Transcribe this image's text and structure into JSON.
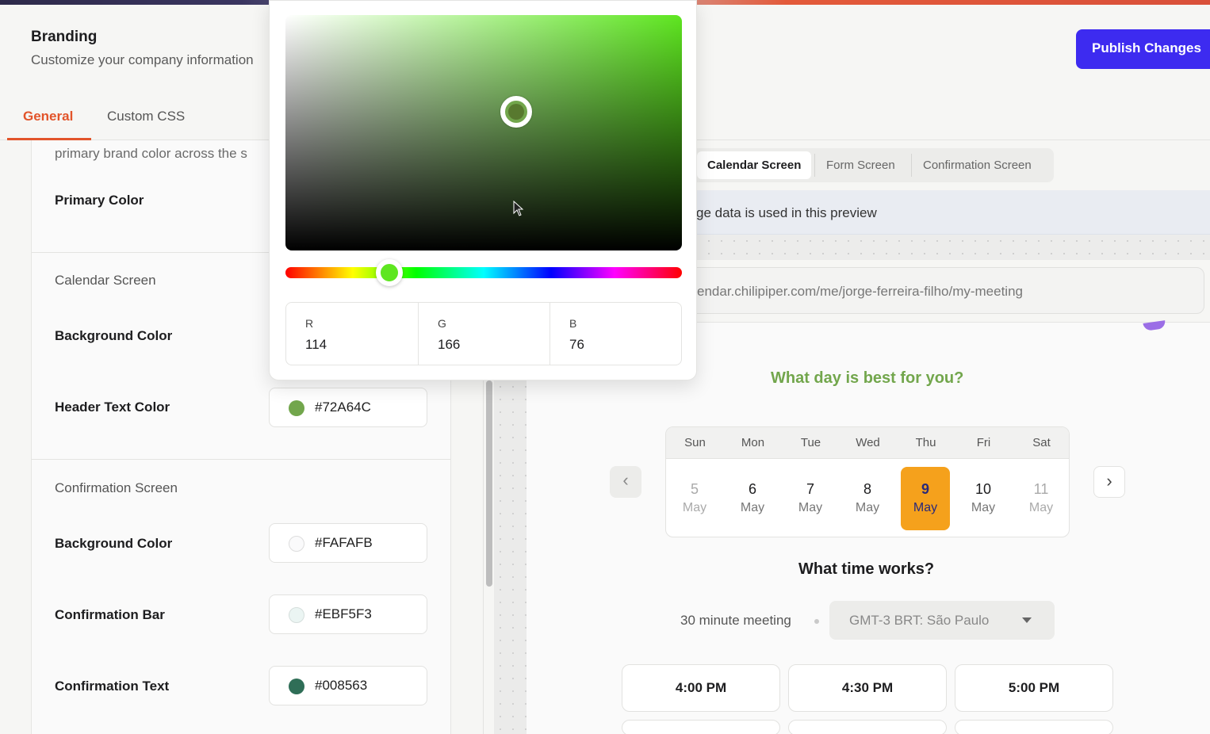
{
  "header": {
    "title": "Branding",
    "subtitle": "Customize your company information",
    "publish_label": "Publish Changes"
  },
  "tabs": [
    {
      "label": "General",
      "active": true
    },
    {
      "label": "Custom CSS",
      "active": false
    }
  ],
  "settings": {
    "intro_text": "primary brand color across the s",
    "primary_color_label": "Primary Color",
    "calendar_section": {
      "title": "Calendar Screen",
      "background_label": "Background Color",
      "header_text_label": "Header Text Color",
      "header_text_value": "#72A64C"
    },
    "confirmation_section": {
      "title": "Confirmation Screen",
      "background_label": "Background Color",
      "background_value": "#FAFAFB",
      "bar_label": "Confirmation Bar",
      "bar_value": "#EBF5F3",
      "text_label": "Confirmation Text",
      "text_value": "#008563"
    }
  },
  "color_picker": {
    "selected_color": "#72A64C",
    "hue_color": "#5EE620",
    "r_label": "R",
    "r_value": "114",
    "g_label": "G",
    "g_value": "166",
    "b_label": "B",
    "b_value": "76"
  },
  "preview": {
    "tabs": [
      "Calendar Screen",
      "Form Screen",
      "Confirmation Screen"
    ],
    "active_tab": "Calendar Screen",
    "info_banner": "ge data is used in this preview",
    "url": "endar.chilipiper.com/me/jorge-ferreira-filho/my-meeting",
    "day_question": "What day is best for you?",
    "weekdays": [
      "Sun",
      "Mon",
      "Tue",
      "Wed",
      "Thu",
      "Fri",
      "Sat"
    ],
    "days": [
      {
        "num": "5",
        "month": "May",
        "state": "disabled"
      },
      {
        "num": "6",
        "month": "May",
        "state": "normal"
      },
      {
        "num": "7",
        "month": "May",
        "state": "normal"
      },
      {
        "num": "8",
        "month": "May",
        "state": "normal"
      },
      {
        "num": "9",
        "month": "May",
        "state": "selected"
      },
      {
        "num": "10",
        "month": "May",
        "state": "normal"
      },
      {
        "num": "11",
        "month": "May",
        "state": "disabled"
      }
    ],
    "prev_icon": "‹",
    "next_icon": "›",
    "time_question": "What time works?",
    "meeting_length": "30 minute meeting",
    "timezone": "GMT-3  BRT: São Paulo",
    "slots": [
      "4:00 PM",
      "4:30 PM",
      "5:00 PM"
    ],
    "selected_day_color": "#F5A11C",
    "heading_color": "#72A64C"
  },
  "colors": {
    "accent": "#E2542A",
    "publish_button": "#3D2BF0"
  }
}
